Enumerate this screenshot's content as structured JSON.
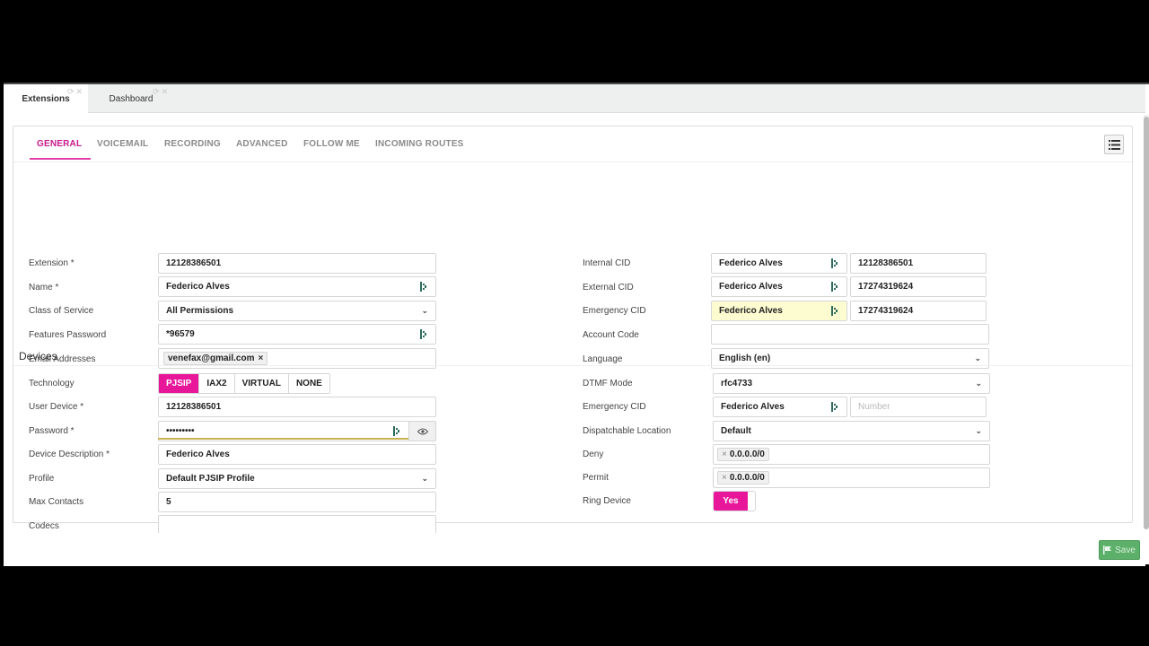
{
  "app_tabs": [
    {
      "label": "Extensions"
    },
    {
      "label": "Dashboard"
    }
  ],
  "section_tabs": [
    {
      "label": "GENERAL"
    },
    {
      "label": "VOICEMAIL"
    },
    {
      "label": "RECORDING"
    },
    {
      "label": "ADVANCED"
    },
    {
      "label": "FOLLOW ME"
    },
    {
      "label": "INCOMING ROUTES"
    }
  ],
  "general": {
    "extension": {
      "label": "Extension *",
      "value": "12128386501"
    },
    "name": {
      "label": "Name *",
      "value": "Federico Alves"
    },
    "class_of_service": {
      "label": "Class of Service",
      "value": "All Permissions"
    },
    "features_password": {
      "label": "Features Password",
      "value": "*96579"
    },
    "email_addresses": {
      "label": "Email Addresses",
      "tag": "venefax@gmail.com"
    },
    "internal_cid": {
      "label": "Internal CID",
      "name": "Federico Alves",
      "number": "12128386501"
    },
    "external_cid": {
      "label": "External CID",
      "name": "Federico Alves",
      "number": "17274319624"
    },
    "emergency_cid": {
      "label": "Emergency CID",
      "name": "Federico Alves",
      "number": "17274319624"
    },
    "account_code": {
      "label": "Account Code",
      "value": ""
    },
    "language": {
      "label": "Language",
      "value": "English (en)"
    }
  },
  "devices": {
    "title": "Devices",
    "technology": {
      "label": "Technology",
      "options": [
        "PJSIP",
        "IAX2",
        "VIRTUAL",
        "NONE"
      ],
      "selected": "PJSIP"
    },
    "user_device": {
      "label": "User Device *",
      "value": "12128386501"
    },
    "password": {
      "label": "Password *",
      "value": "•••••••••"
    },
    "device_description": {
      "label": "Device Description *",
      "value": "Federico Alves"
    },
    "profile": {
      "label": "Profile",
      "value": "Default PJSIP Profile"
    },
    "max_contacts": {
      "label": "Max Contacts",
      "value": "5"
    },
    "codecs": {
      "label": "Codecs",
      "value": ""
    },
    "dtmf_mode": {
      "label": "DTMF Mode",
      "value": "rfc4733"
    },
    "emergency_cid": {
      "label": "Emergency CID",
      "name": "Federico Alves",
      "number_placeholder": "Number"
    },
    "dispatchable_location": {
      "label": "Dispatchable Location",
      "value": "Default"
    },
    "deny": {
      "label": "Deny",
      "tag": "0.0.0.0/0"
    },
    "permit": {
      "label": "Permit",
      "tag": "0.0.0.0/0"
    },
    "ring_device": {
      "label": "Ring Device",
      "value": "Yes"
    }
  },
  "footer": {
    "save_label": "Save"
  },
  "colors": {
    "accent": "#e8179a",
    "save": "#5cb06a",
    "highlight": "#fdfbd0"
  }
}
